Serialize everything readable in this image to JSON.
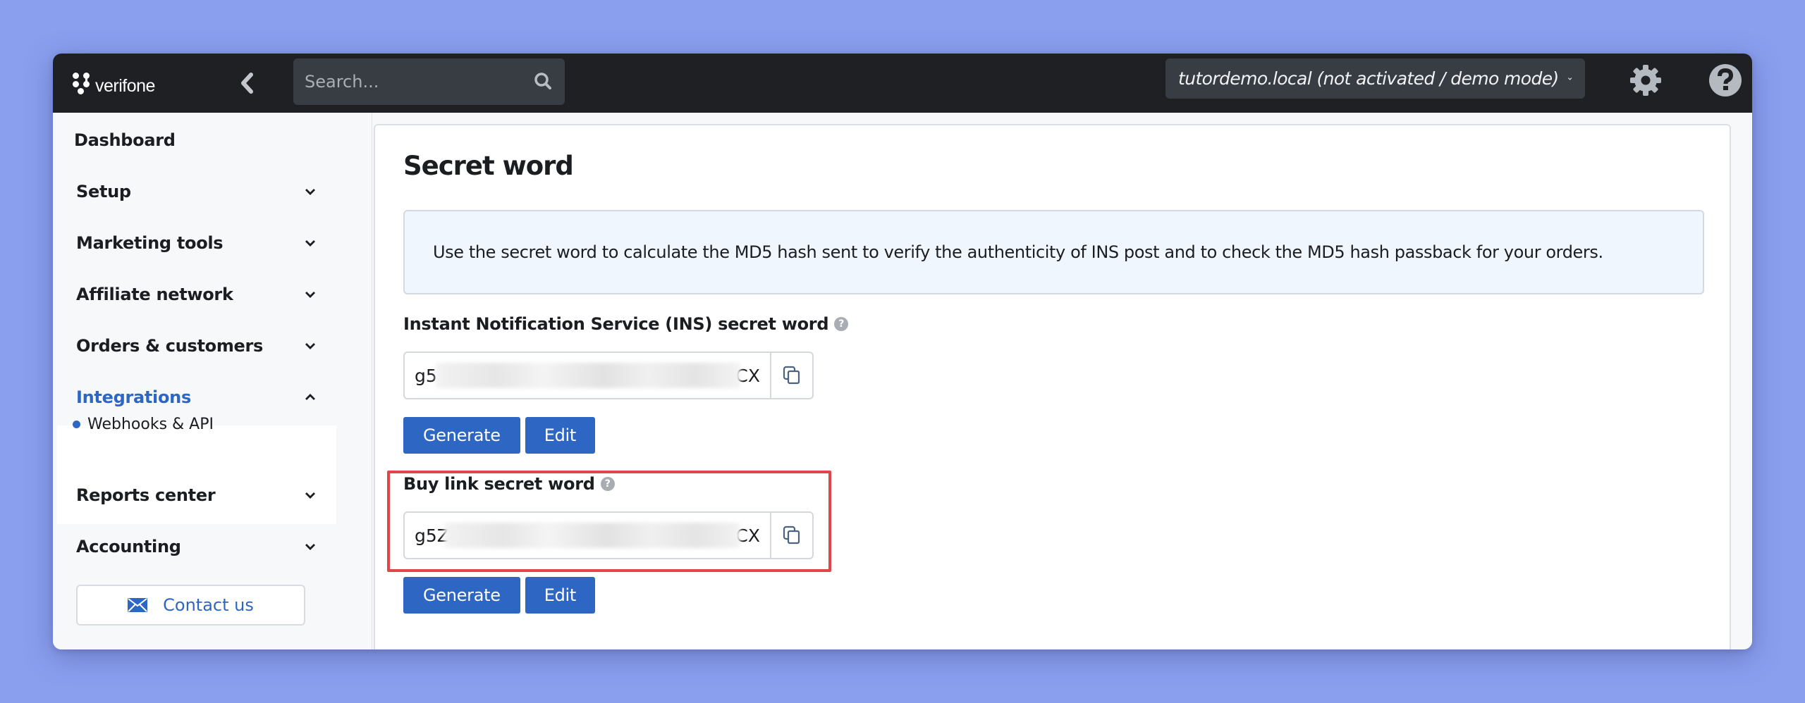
{
  "header": {
    "logo_text": "verifone",
    "search_placeholder": "Search...",
    "account_selector": "tutordemo.local (not activated / demo mode)",
    "icons": {
      "collapse": "chevron-left-icon",
      "search": "search-icon",
      "dropdown": "chevron-down-icon",
      "settings": "gear-icon",
      "help": "question-circle-icon"
    }
  },
  "sidebar": {
    "items": [
      {
        "label": "Dashboard",
        "expandable": false
      },
      {
        "label": "Setup",
        "expandable": true,
        "expanded": false
      },
      {
        "label": "Marketing tools",
        "expandable": true,
        "expanded": false
      },
      {
        "label": "Affiliate network",
        "expandable": true,
        "expanded": false
      },
      {
        "label": "Orders & customers",
        "expandable": true,
        "expanded": false
      },
      {
        "label": "Integrations",
        "expandable": true,
        "expanded": true,
        "active": true,
        "children": [
          {
            "label": "Webhooks & API",
            "active": true
          }
        ]
      },
      {
        "label": "Reports center",
        "expandable": true,
        "expanded": false
      },
      {
        "label": "Accounting",
        "expandable": true,
        "expanded": false
      }
    ],
    "contact_button": "Contact us"
  },
  "main": {
    "title": "Secret word",
    "info_text": "Use the secret word to calculate the MD5 hash sent to verify the authenticity of INS post and to check the MD5 hash passback for your orders.",
    "sections": [
      {
        "label": "Instant Notification Service (INS) secret word",
        "value_start": "g5",
        "value_end": "CX",
        "value_obscured": true,
        "buttons": {
          "generate": "Generate",
          "edit": "Edit"
        },
        "highlighted": false
      },
      {
        "label": "Buy link secret word",
        "value_start": "g5Z",
        "value_end": "dCX",
        "value_obscured": true,
        "buttons": {
          "generate": "Generate",
          "edit": "Edit"
        },
        "highlighted": true
      }
    ]
  },
  "colors": {
    "background": "#8a9fee",
    "topbar": "#1e2024",
    "accent_blue": "#2d66c3",
    "highlight_red": "#e24549",
    "info_bg": "#eff6fd"
  }
}
